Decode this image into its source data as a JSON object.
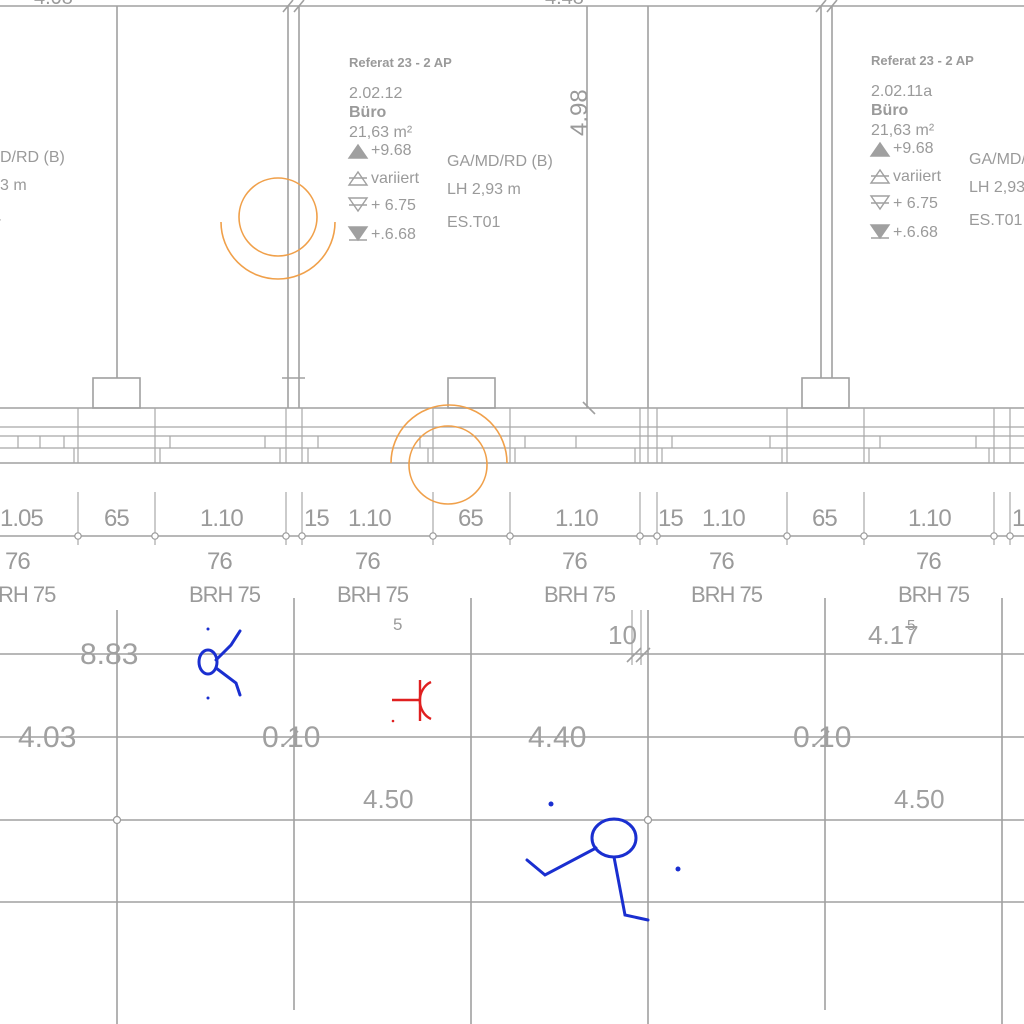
{
  "rooms": [
    {
      "department": "Referat 23 -  2 AP",
      "number": "2.02.12",
      "name": "Büro",
      "area": "21,63 m²",
      "level_top": "+9.68",
      "level_ceiling": "variiert",
      "level_floor": "+ 6.75",
      "level_raw": "+.6.68",
      "floor_type": "GA/MD/RD (B)",
      "clear_height": "LH 2,93 m",
      "finish": "ES.T01"
    },
    {
      "department": "Referat 23 -  2 AP",
      "number": "2.02.11a",
      "name": "Büro",
      "area": "21,63 m²",
      "level_top": "+9.68",
      "level_ceiling": "variiert",
      "level_floor": "+ 6.75",
      "level_raw": "+.6.68",
      "floor_type": "GA/MD/RD (B)",
      "clear_height": "LH 2,93 m",
      "finish": "ES.T01"
    }
  ],
  "left_room_fragment": {
    "floor_type": "D/RD (B)",
    "clear_height": "3 m"
  },
  "vertical_dimension": "4.98",
  "window_dims": [
    "1.05",
    "65",
    "1.10",
    "15",
    "1.10",
    "65",
    "1.10",
    "15",
    "1.10",
    "65",
    "1.10",
    "1"
  ],
  "sill_dims": [
    "76",
    "76",
    "76",
    "76",
    "76",
    "76"
  ],
  "brh_labels": [
    "RH 75",
    "BRH 75",
    "BRH 75",
    "BRH 75",
    "BRH 75",
    "BRH 75"
  ],
  "grid_labels": {
    "a": "8.83",
    "b": "4.03",
    "c": "0.10",
    "d": "4.40",
    "e": "0.10",
    "f": "4.50",
    "g": "4.50",
    "h": "4.17",
    "h_sup": "5",
    "i": "10",
    "j": "5"
  },
  "colors": {
    "lines": "#a0a0a0",
    "annotation_orange": "#f0a04a",
    "markup_blue": "#1a2fd0",
    "markup_red": "#e02020"
  }
}
